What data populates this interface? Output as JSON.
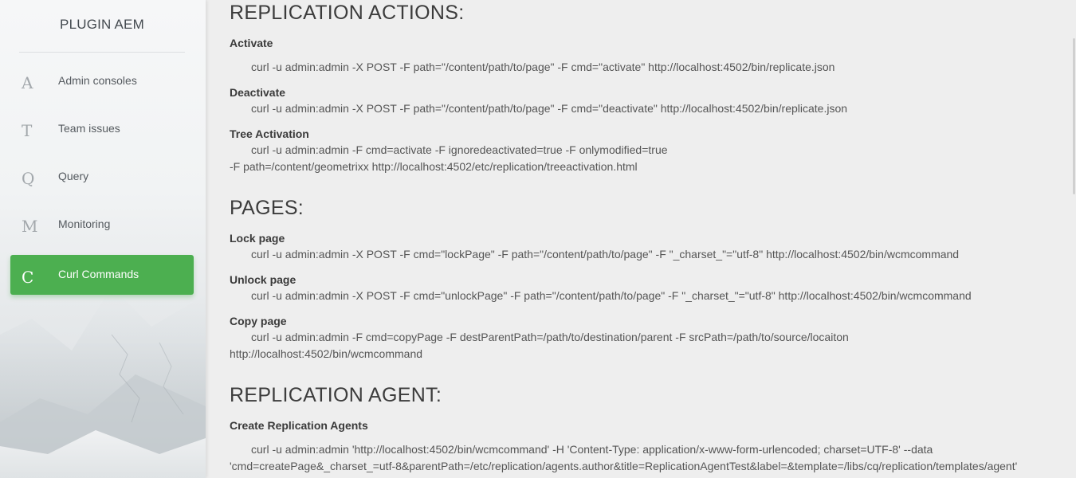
{
  "app": {
    "title": "PLUGIN AEM"
  },
  "sidebar": {
    "items": [
      {
        "letter": "A",
        "label": "Admin consoles"
      },
      {
        "letter": "T",
        "label": "Team issues"
      },
      {
        "letter": "Q",
        "label": "Query"
      },
      {
        "letter": "M",
        "label": "Monitoring"
      },
      {
        "letter": "C",
        "label": "Curl Commands",
        "active": true
      }
    ]
  },
  "colors": {
    "accent": "#4caf50",
    "background": "#eeeeee"
  },
  "sections": {
    "replication_actions": {
      "title": "REPLICATION ACTIONS:",
      "activate": {
        "label": "Activate",
        "cmd": "curl -u admin:admin -X POST -F path=\"/content/path/to/page\" -F cmd=\"activate\" http://localhost:4502/bin/replicate.json"
      },
      "deactivate": {
        "label": "Deactivate",
        "cmd": "curl -u admin:admin -X POST -F path=\"/content/path/to/page\" -F cmd=\"deactivate\" http://localhost:4502/bin/replicate.json"
      },
      "tree_activation": {
        "label": "Tree Activation",
        "cmd_line1": "curl -u admin:admin -F cmd=activate -F ignoredeactivated=true -F onlymodified=true",
        "cmd_line2": "-F path=/content/geometrixx http://localhost:4502/etc/replication/treeactivation.html"
      }
    },
    "pages": {
      "title": "PAGES:",
      "lock": {
        "label": "Lock page",
        "cmd": "curl -u admin:admin -X POST -F cmd=\"lockPage\" -F path=\"/content/path/to/page\" -F \"_charset_\"=\"utf-8\" http://localhost:4502/bin/wcmcommand"
      },
      "unlock": {
        "label": "Unlock page",
        "cmd": "curl -u admin:admin -X POST -F cmd=\"unlockPage\" -F path=\"/content/path/to/page\" -F \"_charset_\"=\"utf-8\" http://localhost:4502/bin/wcmcommand"
      },
      "copy": {
        "label": "Copy page",
        "cmd_line1": "curl -u admin:admin -F cmd=copyPage -F destParentPath=/path/to/destination/parent -F srcPath=/path/to/source/locaiton",
        "cmd_line2": "http://localhost:4502/bin/wcmcommand"
      }
    },
    "replication_agent": {
      "title": "REPLICATION AGENT:",
      "create": {
        "label": "Create Replication Agents",
        "cmd_line1": "curl -u admin:admin 'http://localhost:4502/bin/wcmcommand' -H 'Content-Type: application/x-www-form-urlencoded; charset=UTF-8' --data",
        "cmd_line2": "'cmd=createPage&_charset_=utf-8&parentPath=/etc/replication/agents.author&title=ReplicationAgentTest&label=&template=/libs/cq/replication/templates/agent'"
      }
    }
  }
}
